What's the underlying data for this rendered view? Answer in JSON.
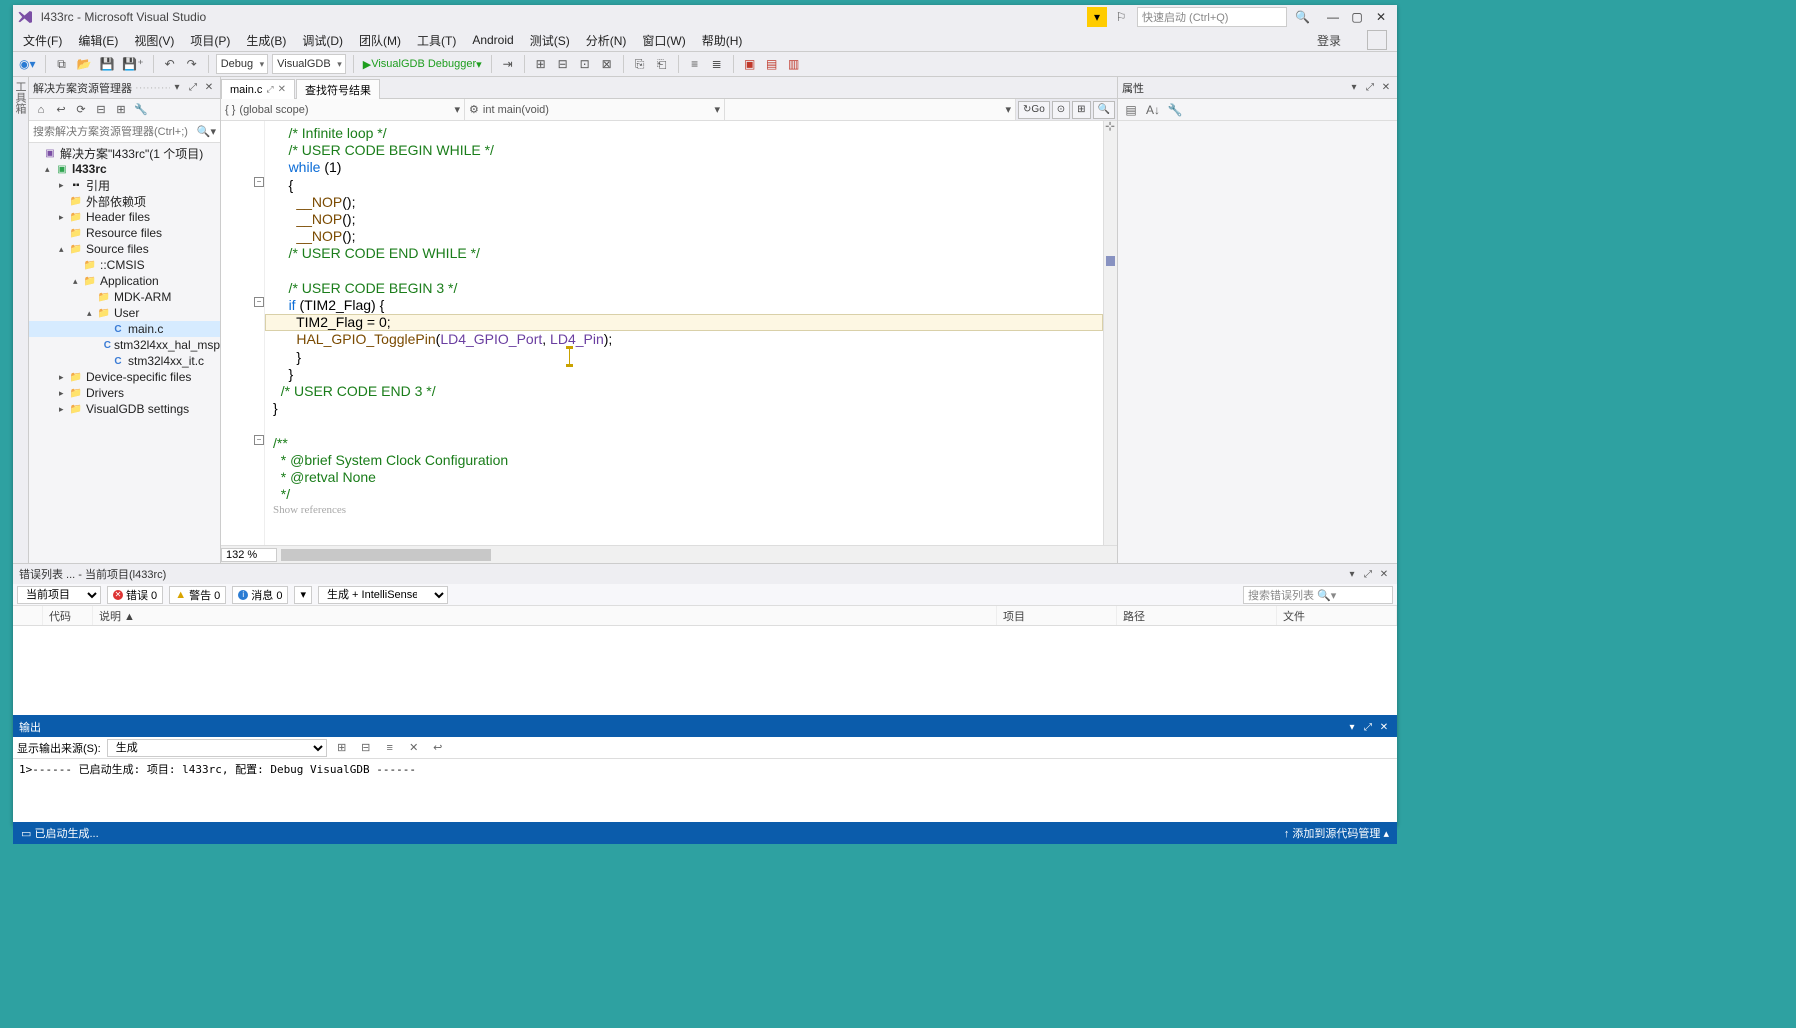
{
  "titlebar": {
    "title": "l433rc - Microsoft Visual Studio",
    "quickstart_placeholder": "快速启动 (Ctrl+Q)",
    "login_label": "登录"
  },
  "menu": {
    "items": [
      "文件(F)",
      "编辑(E)",
      "视图(V)",
      "项目(P)",
      "生成(B)",
      "调试(D)",
      "团队(M)",
      "工具(T)",
      "Android",
      "测试(S)",
      "分析(N)",
      "窗口(W)",
      "帮助(H)"
    ]
  },
  "toolbar": {
    "config_combo": "Debug",
    "platform_combo": "VisualGDB",
    "debugger_label": "VisualGDB Debugger"
  },
  "solution_explorer": {
    "title": "解决方案资源管理器",
    "search_placeholder": "搜索解决方案资源管理器(Ctrl+;)",
    "root": "解决方案\"l433rc\"(1 个项目)",
    "project": "l433rc",
    "nodes": [
      {
        "label": "引用"
      },
      {
        "label": "外部依赖项"
      },
      {
        "label": "Header files"
      },
      {
        "label": "Resource files"
      },
      {
        "label": "Source files",
        "children": [
          {
            "label": "::CMSIS"
          },
          {
            "label": "Application",
            "children": [
              {
                "label": "MDK-ARM"
              },
              {
                "label": "User",
                "children": [
                  {
                    "label": "main.c",
                    "selected": true
                  },
                  {
                    "label": "stm32l4xx_hal_msp"
                  },
                  {
                    "label": "stm32l4xx_it.c"
                  }
                ]
              }
            ]
          }
        ]
      },
      {
        "label": "Device-specific files"
      },
      {
        "label": "Drivers"
      },
      {
        "label": "VisualGDB settings"
      }
    ]
  },
  "editor": {
    "tabs": [
      {
        "label": "main.c",
        "pinned": true,
        "active": true
      },
      {
        "label": "查找符号结果",
        "pinned": false,
        "active": false
      }
    ],
    "nav_scope": "(global scope)",
    "nav_member": "int main(void)",
    "go_label": "Go",
    "zoom": "132 %",
    "show_refs": "Show references",
    "code_lines": [
      {
        "t": "    /* Infinite loop */",
        "cls": "c-comment"
      },
      {
        "t": "    /* USER CODE BEGIN WHILE */",
        "cls": "c-comment"
      },
      {
        "t": "    while (1)",
        "seg": [
          [
            "    ",
            ""
          ],
          [
            "while",
            "c-kw"
          ],
          [
            " (1)",
            ""
          ]
        ]
      },
      {
        "t": "    {"
      },
      {
        "t": "      __NOP();",
        "seg": [
          [
            "      ",
            ""
          ],
          [
            "__NOP",
            "c-fn"
          ],
          [
            "();",
            ""
          ]
        ]
      },
      {
        "t": "      __NOP();",
        "seg": [
          [
            "      ",
            ""
          ],
          [
            "__NOP",
            "c-fn"
          ],
          [
            "();",
            ""
          ]
        ]
      },
      {
        "t": "      __NOP();",
        "seg": [
          [
            "      ",
            ""
          ],
          [
            "__NOP",
            "c-fn"
          ],
          [
            "();",
            ""
          ]
        ]
      },
      {
        "t": "    /* USER CODE END WHILE */",
        "cls": "c-comment"
      },
      {
        "t": ""
      },
      {
        "t": "    /* USER CODE BEGIN 3 */",
        "cls": "c-comment"
      },
      {
        "t": "    if (TIM2_Flag) {",
        "seg": [
          [
            "    ",
            ""
          ],
          [
            "if",
            "c-kw"
          ],
          [
            " (TIM2_Flag) {",
            ""
          ]
        ]
      },
      {
        "t": "      TIM2_Flag = 0;",
        "hl": true
      },
      {
        "t": "      HAL_GPIO_TogglePin(LD4_GPIO_Port, LD4_Pin);",
        "seg": [
          [
            "      ",
            ""
          ],
          [
            "HAL_GPIO_TogglePin",
            "c-fn"
          ],
          [
            "(",
            ""
          ],
          [
            "LD4_GPIO_Port",
            "c-macro"
          ],
          [
            ", ",
            ""
          ],
          [
            "LD4_Pin",
            "c-macro"
          ],
          [
            ");",
            ""
          ]
        ]
      },
      {
        "t": "      }"
      },
      {
        "t": "    }"
      },
      {
        "t": "  /* USER CODE END 3 */",
        "cls": "c-comment"
      },
      {
        "t": "}"
      },
      {
        "t": ""
      },
      {
        "t": "/**",
        "cls": "c-comment"
      },
      {
        "t": "  * @brief System Clock Configuration",
        "cls": "c-comment"
      },
      {
        "t": "  * @retval None",
        "cls": "c-comment"
      },
      {
        "t": "  */",
        "cls": "c-comment"
      }
    ]
  },
  "properties": {
    "title": "属性"
  },
  "error_list": {
    "title": "错误列表 ... - 当前项目(l433rc)",
    "scope": "当前项目",
    "errors_label": "错误 0",
    "warnings_label": "警告 0",
    "messages_label": "消息 0",
    "source_combo": "生成 + IntelliSense",
    "search_placeholder": "搜索错误列表",
    "columns": [
      "",
      "代码",
      "说明 ▲",
      "项目",
      "路径",
      "文件"
    ]
  },
  "output": {
    "title": "输出",
    "source_label": "显示输出来源(S):",
    "source_value": "生成",
    "text": "1>------ 已启动生成: 项目: l433rc, 配置: Debug VisualGDB ------"
  },
  "statusbar": {
    "left": "已启动生成...",
    "right": "↑ 添加到源代码管理 ▴"
  }
}
